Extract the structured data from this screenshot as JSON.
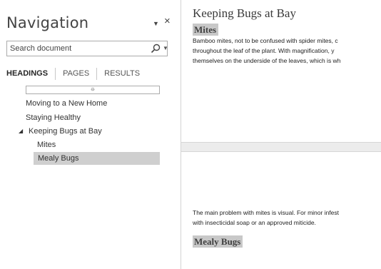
{
  "navigation": {
    "title": "Navigation",
    "menu_glyph": "▼",
    "close_glyph": "×",
    "search": {
      "placeholder": "Search document",
      "dropdown_glyph": "▼"
    },
    "tabs": [
      {
        "label": "HEADINGS",
        "active": true
      },
      {
        "label": "PAGES",
        "active": false
      },
      {
        "label": "RESULTS",
        "active": false
      }
    ],
    "collapse_glyph": "⯐",
    "expand_glyph": "◢",
    "headings": [
      {
        "label": "Moving to a New Home",
        "level": 1,
        "selected": false
      },
      {
        "label": "Staying Healthy",
        "level": 1,
        "selected": false
      },
      {
        "label": "Keeping Bugs at Bay",
        "level": 1,
        "selected": false,
        "expanded": true
      },
      {
        "label": "Mites",
        "level": 2,
        "selected": false
      },
      {
        "label": "Mealy Bugs",
        "level": 2,
        "selected": true
      }
    ]
  },
  "document": {
    "heading1": "Keeping Bugs at Bay",
    "section1": {
      "heading": "Mites",
      "lines": [
        "Bamboo mites, not to be confused with spider mites, c",
        "throughout the leaf of the plant. With magnification, y",
        "themselves on the underside of the leaves, which is wh"
      ]
    },
    "page2_lines": [
      "The main problem with mites is visual. For minor infest",
      "with insecticidal soap or an approved miticide."
    ],
    "section2": {
      "heading": "Mealy Bugs"
    }
  }
}
